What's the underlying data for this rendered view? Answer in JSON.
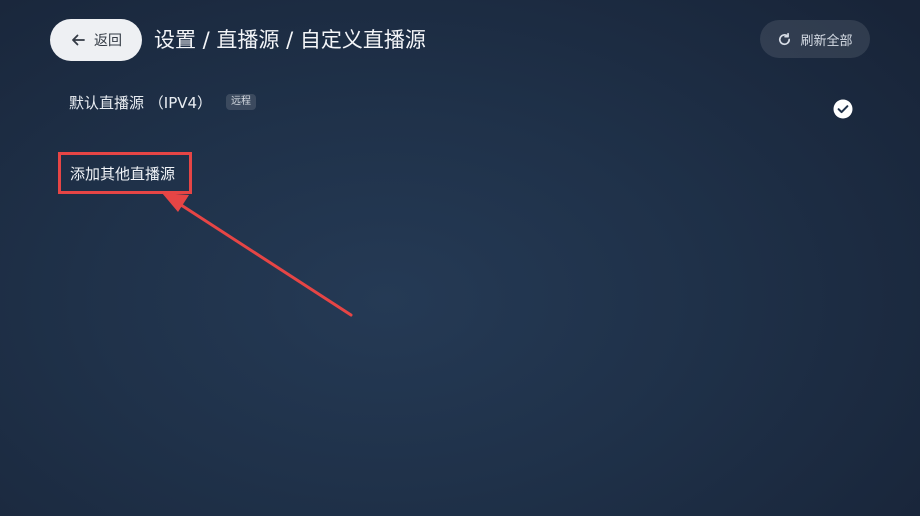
{
  "header": {
    "back_label": "返回",
    "title": "设置 / 直播源 / 自定义直播源",
    "refresh_label": "刷新全部"
  },
  "sources": [
    {
      "name": "默认直播源 （IPV4）",
      "tag": "远程",
      "selected": true
    }
  ],
  "add_source_label": "添加其他直播源",
  "icons": {
    "back": "arrow-left-icon",
    "refresh": "refresh-icon",
    "selected": "check-circle-icon"
  },
  "colors": {
    "background": "#1f3149",
    "highlight_border": "#e64545",
    "annotation_arrow": "#e64545",
    "button_light": "#eef0f3"
  }
}
